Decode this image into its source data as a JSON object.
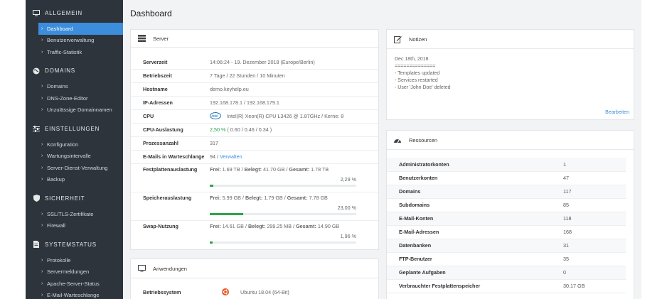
{
  "sidebar": {
    "sections": [
      {
        "label": "ALLGEMEIN",
        "icon": "monitor-icon",
        "items": [
          {
            "label": "Dashboard",
            "active": true
          },
          {
            "label": "Benutzerverwaltung"
          },
          {
            "label": "Traffic-Statistik"
          }
        ]
      },
      {
        "label": "DOMAINS",
        "icon": "globe-icon",
        "items": [
          {
            "label": "Domains"
          },
          {
            "label": "DNS-Zone-Editor"
          },
          {
            "label": "Unzulässige Domainnamen"
          }
        ]
      },
      {
        "label": "EINSTELLUNGEN",
        "icon": "sliders-icon",
        "items": [
          {
            "label": "Konfiguration"
          },
          {
            "label": "Wartungsintervalle"
          },
          {
            "label": "Server-Dienst-Verwaltung"
          },
          {
            "label": "Backup"
          }
        ]
      },
      {
        "label": "SICHERHEIT",
        "icon": "shield-icon",
        "items": [
          {
            "label": "SSL/TLS-Zertifikate"
          },
          {
            "label": "Firewall"
          }
        ]
      },
      {
        "label": "SYSTEMSTATUS",
        "icon": "file-icon",
        "items": [
          {
            "label": "Protokolle"
          },
          {
            "label": "Servermeldungen"
          },
          {
            "label": "Apache-Server-Status"
          },
          {
            "label": "E-Mail-Warteschlange"
          }
        ]
      }
    ]
  },
  "main": {
    "title": "Dashboard",
    "server": {
      "title": "Server",
      "rows": {
        "serverzeit": {
          "k": "Serverzeit",
          "v": "14:06:24 - 19. Dezember 2018 (Europe/Berlin)"
        },
        "betriebszeit": {
          "k": "Betriebszeit",
          "v": "7 Tage / 22 Stunden / 10 Minuten"
        },
        "hostname": {
          "k": "Hostname",
          "v": "demo.keyhelp.eu"
        },
        "ip": {
          "k": "IP-Adressen",
          "v": "192.168.178.1 / 192.168.179.1"
        },
        "cpu": {
          "k": "CPU",
          "brand": "intel",
          "v": "Intel(R) Xeon(R) CPU L3426 @ 1.87GHz / Kerne: 8"
        },
        "cpu_load": {
          "k": "CPU-Auslastung",
          "pct": "2,50 %",
          "v": "( 0.60 / 0.46 / 0.34 )"
        },
        "procs": {
          "k": "Prozessanzahl",
          "v": "317"
        },
        "mailq": {
          "k": "E-Mails in Warteschlange",
          "v": "94 /",
          "link": "Verwalten"
        },
        "disk": {
          "k": "Festplattenauslastung",
          "frei_l": "Frei:",
          "frei": "1.69 TB",
          "beleg_l": "Belegt:",
          "beleg": "41.70 GB",
          "ges_l": "Gesamt:",
          "ges": "1.78 TB",
          "sep": "/",
          "pct_text": "2,29 %",
          "fill": 0.0229
        },
        "mem": {
          "k": "Speicherauslastung",
          "frei_l": "Frei:",
          "frei": "5.99 GB",
          "beleg_l": "Belegt:",
          "beleg": "1.79 GB",
          "ges_l": "Gesamt:",
          "ges": "7.78 GB",
          "sep": "/",
          "pct_text": "23,00 %",
          "fill": 0.23
        },
        "swap": {
          "k": "Swap-Nutzung",
          "frei_l": "Frei:",
          "frei": "14.61 GB",
          "beleg_l": "Belegt:",
          "beleg": "299.25 MB",
          "ges_l": "Gesamt:",
          "ges": "14.90 GB",
          "sep": "/",
          "pct_text": "1,96 %",
          "fill": 0.0196
        }
      }
    },
    "apps": {
      "title": "Anwendungen",
      "row": {
        "k": "Betriebssystem",
        "v": "Ubuntu 18.04 (64-Bit)"
      }
    },
    "notes": {
      "title": "Notizen",
      "lines": [
        "Dec 18th, 2018",
        "==============",
        "- Templates updated",
        "- Services restarted",
        "- User 'John Doe' deleted"
      ],
      "edit_link": "Bearbeiten"
    },
    "resources": {
      "title": "Ressourcen",
      "rows": [
        {
          "k": "Administratorkonten",
          "v": "1"
        },
        {
          "k": "Benutzerkonten",
          "v": "47"
        },
        {
          "k": "Domains",
          "v": "117"
        },
        {
          "k": "Subdomains",
          "v": "85"
        },
        {
          "k": "E-Mail-Konten",
          "v": "118"
        },
        {
          "k": "E-Mail-Adressen",
          "v": "168"
        },
        {
          "k": "Datenbanken",
          "v": "31"
        },
        {
          "k": "FTP-Benutzer",
          "v": "35"
        },
        {
          "k": "Geplante Aufgaben",
          "v": "0"
        },
        {
          "k": "Verbrauchter Festplattenspeicher",
          "v": "30.17 GB"
        }
      ]
    }
  }
}
